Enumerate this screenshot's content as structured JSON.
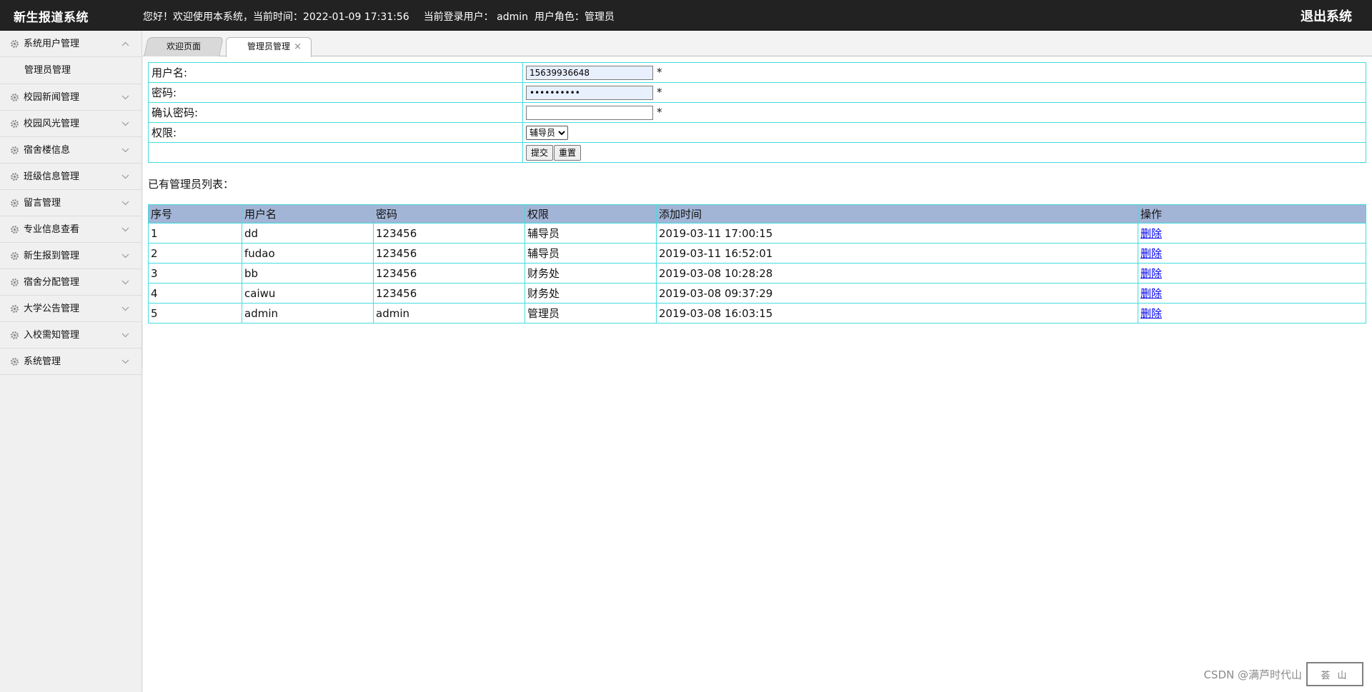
{
  "header": {
    "brand": "新生报道系统",
    "greeting": "您好！欢迎使用本系统，当前时间：2022-01-09 17:31:56",
    "current_user": "当前登录用户： admin",
    "user_role": "用户角色：管理员",
    "logout": "退出系统"
  },
  "sidebar": {
    "items": [
      {
        "label": "系统用户管理",
        "expanded": true,
        "children": [
          "管理员管理"
        ]
      },
      {
        "label": "校园新闻管理"
      },
      {
        "label": "校园风光管理"
      },
      {
        "label": "宿舍楼信息"
      },
      {
        "label": "班级信息管理"
      },
      {
        "label": "留言管理"
      },
      {
        "label": "专业信息查看"
      },
      {
        "label": "新生报到管理"
      },
      {
        "label": "宿舍分配管理"
      },
      {
        "label": "大学公告管理"
      },
      {
        "label": "入校需知管理"
      },
      {
        "label": "系统管理"
      }
    ]
  },
  "tabs": [
    {
      "label": "欢迎页面"
    },
    {
      "label": "管理员管理",
      "active": true
    }
  ],
  "form": {
    "username_label": "用户名:",
    "username_value": "15639936648",
    "password_label": "密码:",
    "password_value": "••••••••••",
    "confirm_label": "确认密码:",
    "confirm_value": "",
    "required_mark": "*",
    "role_label": "权限:",
    "role_selected": "辅导员",
    "submit": "提交",
    "reset": "重置"
  },
  "list": {
    "title": "已有管理员列表：",
    "columns": [
      "序号",
      "用户名",
      "密码",
      "权限",
      "添加时间",
      "操作"
    ],
    "rows": [
      [
        "1",
        "dd",
        "123456",
        "辅导员",
        "2019-03-11 17:00:15",
        "删除"
      ],
      [
        "2",
        "fudao",
        "123456",
        "辅导员",
        "2019-03-11 16:52:01",
        "删除"
      ],
      [
        "3",
        "bb",
        "123456",
        "财务处",
        "2019-03-08 10:28:28",
        "删除"
      ],
      [
        "4",
        "caiwu",
        "123456",
        "财务处",
        "2019-03-08 09:37:29",
        "删除"
      ],
      [
        "5",
        "admin",
        "admin",
        "管理员",
        "2019-03-08 16:03:15",
        "删除"
      ]
    ]
  },
  "watermark": "CSDN @满芦时代山",
  "colors": {
    "header_bg": "#222222",
    "table_border": "#44dbe0",
    "table_header_bg": "#a3b5d6",
    "link": "#0000ee"
  }
}
